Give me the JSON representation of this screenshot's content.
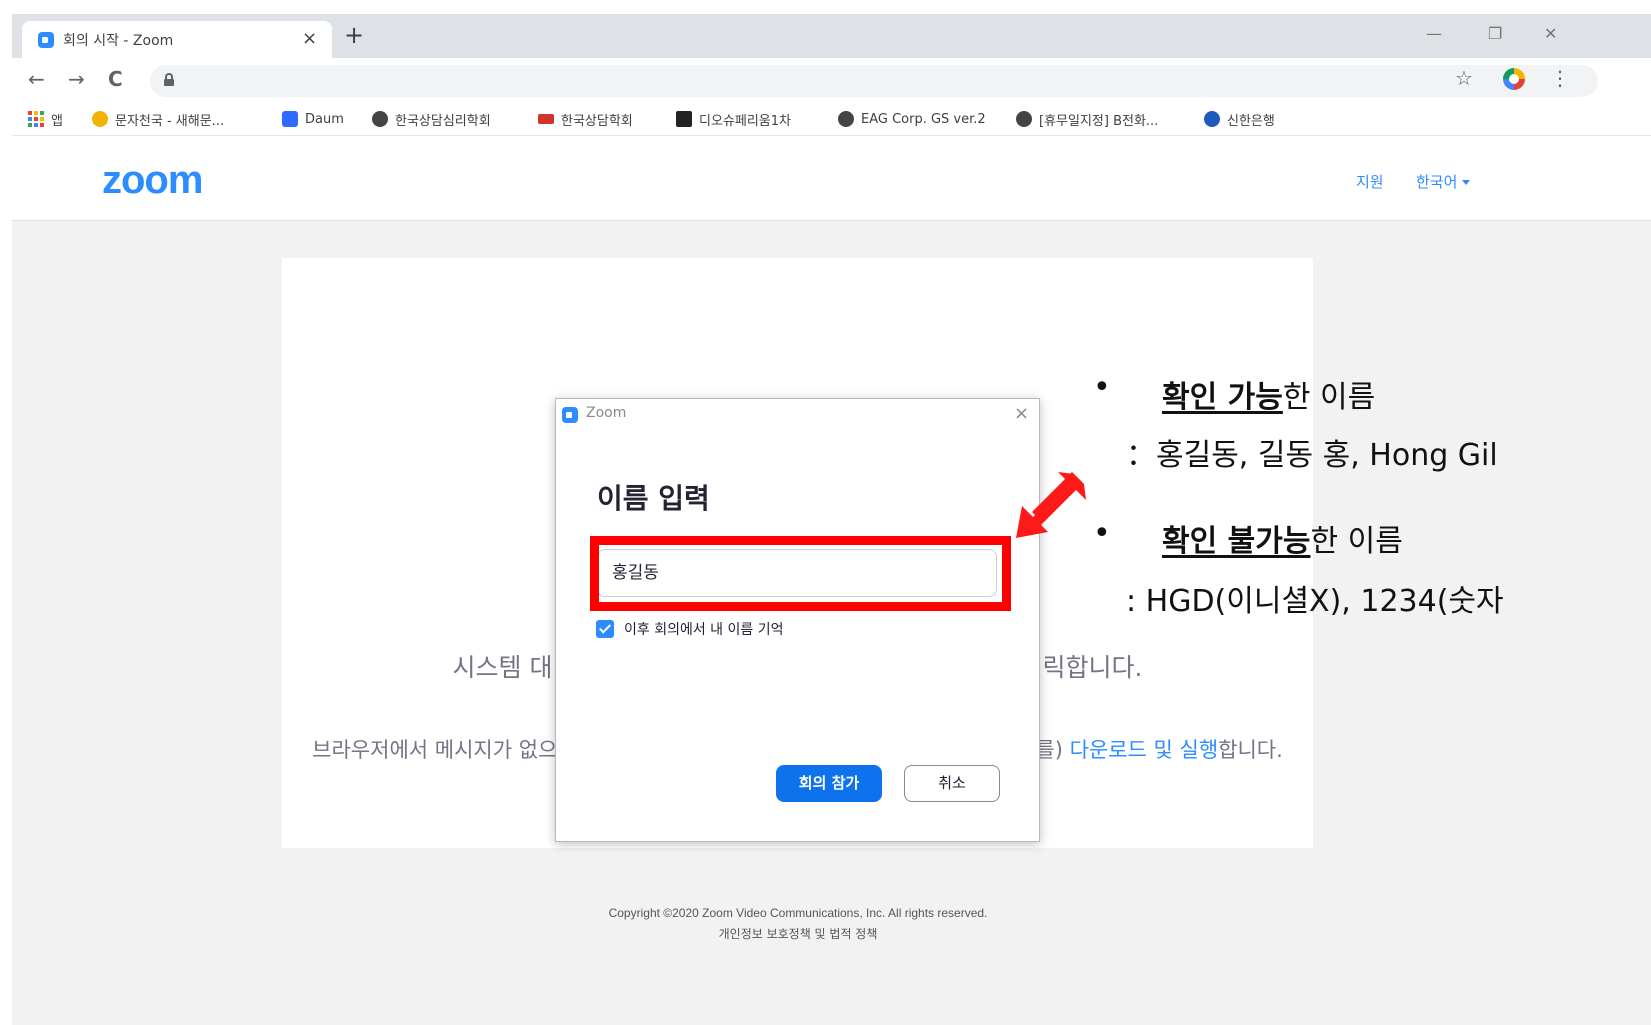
{
  "browser": {
    "tab_title": "회의 시작 - Zoom",
    "tab_close": "×",
    "new_tab": "+",
    "window_controls": [
      "—",
      "❐",
      "✕"
    ],
    "nav": {
      "back": "←",
      "forward": "→",
      "reload": "C"
    },
    "bookmarks": [
      {
        "label": "앱",
        "icon": "apps-icon"
      },
      {
        "label": "문자천국 - 새해문...",
        "icon": "mail-icon",
        "color": "#f0b400"
      },
      {
        "label": "Daum",
        "icon": "daum-icon",
        "color": "#2d6bff"
      },
      {
        "label": "한국상담심리학회",
        "icon": "globe-icon",
        "color": "#444444"
      },
      {
        "label": "한국상담학회",
        "icon": "kca-icon",
        "color": "#d0342c"
      },
      {
        "label": "디오슈페리움1차",
        "icon": "triangle-icon",
        "color": "#222222"
      },
      {
        "label": "EAG Corp. GS ver.2",
        "icon": "globe-icon",
        "color": "#444444"
      },
      {
        "label": "[휴무일지정] B전화...",
        "icon": "globe-icon",
        "color": "#444444"
      },
      {
        "label": "신한은행",
        "icon": "shinhan-icon",
        "color": "#1e5bb8"
      }
    ]
  },
  "zoom_page": {
    "logo": "zoom",
    "header_links": {
      "support": "지원",
      "language": "한국어"
    },
    "launch_text_left": "시스템 대",
    "launch_text_right": "릭합니다.",
    "download_text_left": "브라우저에서 메시지가 없으",
    "download_text_mid": "를) ",
    "download_link": "다운로드 및 실행",
    "download_text_end": "합니다.",
    "footer_copyright": "Copyright ©2020 Zoom Video Communications, Inc. All rights reserved.",
    "footer_policy": "개인정보 보호정책 및 법적 정책"
  },
  "dialog": {
    "title": "Zoom",
    "close": "×",
    "heading": "이름 입력",
    "name_value": "홍길동",
    "remember_label": "이후 회의에서 내 이름 기억",
    "remember_checked": true,
    "join_button": "회의 참가",
    "cancel_button": "취소"
  },
  "annotations": {
    "highlight_color": "#ff0000",
    "valid_bold": "확인 가능",
    "valid_rest": "한 이름",
    "valid_examples": "：홍길동,  길동 홍,  Hong Gil",
    "invalid_bold": "확인 불가능",
    "invalid_rest": "한 이름",
    "invalid_examples": ": HGD(이니셜X),  1234(숫자"
  }
}
